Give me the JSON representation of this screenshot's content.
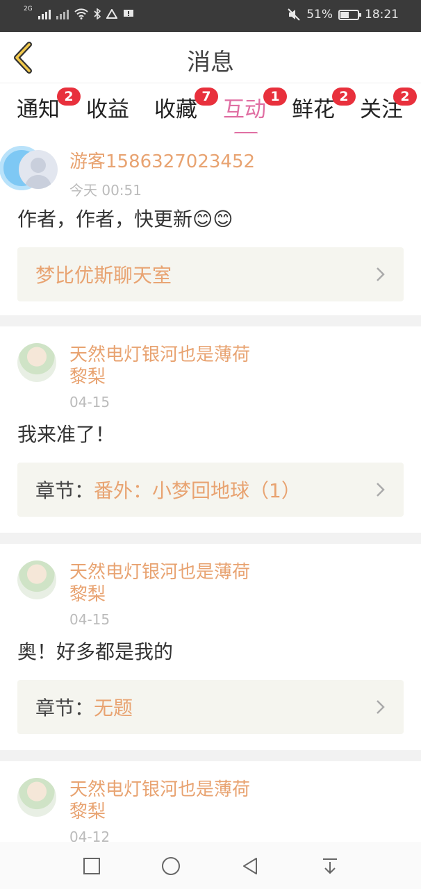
{
  "status_bar": {
    "network": "2G",
    "battery_percent": "51%",
    "battery_level": 0.51,
    "time": "18:21"
  },
  "header": {
    "title": "消息",
    "back_icon": "chevron-left-icon"
  },
  "tabs": [
    {
      "label": "通知",
      "badge": "2",
      "active": false
    },
    {
      "label": "收益",
      "badge": "",
      "active": false
    },
    {
      "label": "收藏",
      "badge": "7",
      "active": false
    },
    {
      "label": "互动",
      "badge": "1",
      "active": true
    },
    {
      "label": "鲜花",
      "badge": "2",
      "active": false
    },
    {
      "label": "关注",
      "badge": "2",
      "active": false
    }
  ],
  "messages": [
    {
      "user": "游客1586327023452",
      "time": "今天 00:51",
      "content": "作者，作者，快更新😊😊",
      "ref_label": "",
      "ref_value": "梦比优斯聊天室"
    },
    {
      "user_line1": "天然电灯银河也是薄荷",
      "user_line2": "黎梨",
      "time": "04-15",
      "content": "我来准了！",
      "ref_label": "章节：",
      "ref_value": "番外：小梦回地球（1）"
    },
    {
      "user_line1": "天然电灯银河也是薄荷",
      "user_line2": "黎梨",
      "time": "04-15",
      "content": "奥！好多都是我的",
      "ref_label": "章节：",
      "ref_value": "无题"
    },
    {
      "user_line1": "天然电灯银河也是薄荷",
      "user_line2": "黎梨",
      "time": "04-12"
    }
  ],
  "colors": {
    "accent": "#e06fa3",
    "username": "#e8a371",
    "badge": "#e8303c"
  }
}
